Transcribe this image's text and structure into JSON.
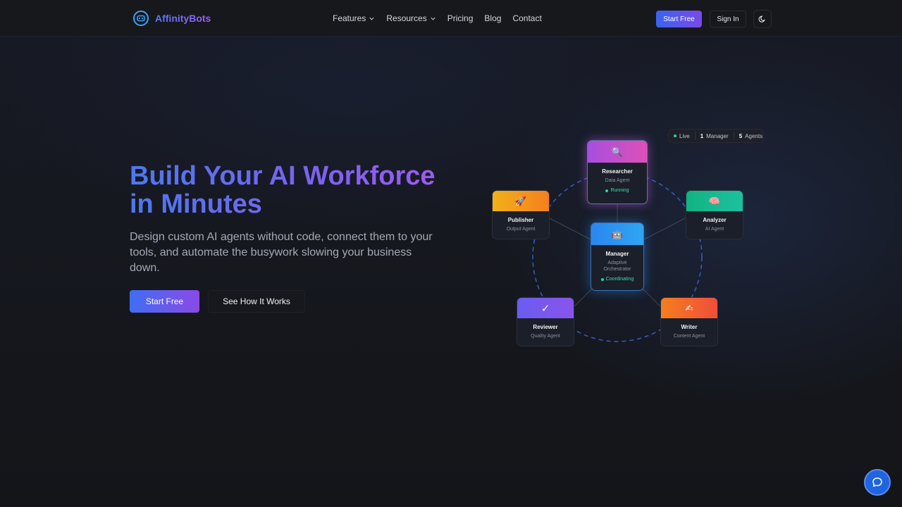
{
  "brand": {
    "name": "AffinityBots"
  },
  "nav": {
    "items": [
      {
        "label": "Features",
        "dropdown": true
      },
      {
        "label": "Resources",
        "dropdown": true
      },
      {
        "label": "Pricing",
        "dropdown": false
      },
      {
        "label": "Blog",
        "dropdown": false
      },
      {
        "label": "Contact",
        "dropdown": false
      }
    ],
    "start_label": "Start Free",
    "signin_label": "Sign In",
    "theme_icon": "moon-icon"
  },
  "hero": {
    "title": "Build Your AI Workforce in Minutes",
    "subtitle": "Design custom AI agents without code, connect them to your tools, and automate the busywork slowing your business down.",
    "primary_cta": "Start Free",
    "secondary_cta": "See How It Works"
  },
  "status": {
    "live": "Live",
    "manager_count": "1",
    "manager_label": "Manager",
    "agent_count": "5",
    "agent_label": "Agents"
  },
  "agents": {
    "researcher": {
      "icon": "🔍",
      "name": "Researcher",
      "role": "Data Agent",
      "status": "Running",
      "head_color": "#c14fdc"
    },
    "publisher": {
      "icon": "🚀",
      "name": "Publisher",
      "role": "Output Agent",
      "head_color": "#f39a16"
    },
    "analyzer": {
      "icon": "🧠",
      "name": "Analyzer",
      "role": "AI Agent",
      "head_color": "#16b98a"
    },
    "manager": {
      "icon": "🤖",
      "name": "Manager",
      "role": "Adaptive Orchestrator",
      "status": "Coordinating",
      "head_color": "#2f8ef0"
    },
    "reviewer": {
      "icon": "✓",
      "name": "Reviewer",
      "role": "Quality Agent",
      "head_color": "#7756ee"
    },
    "writer": {
      "icon": "✍",
      "name": "Writer",
      "role": "Content Agent",
      "head_color": "#f0642a"
    }
  },
  "colors": {
    "accent_blue": "#3f6ef2",
    "accent_purple": "#8a4ae6",
    "status_green": "#3fdcae",
    "page_bg": "#15171d"
  }
}
